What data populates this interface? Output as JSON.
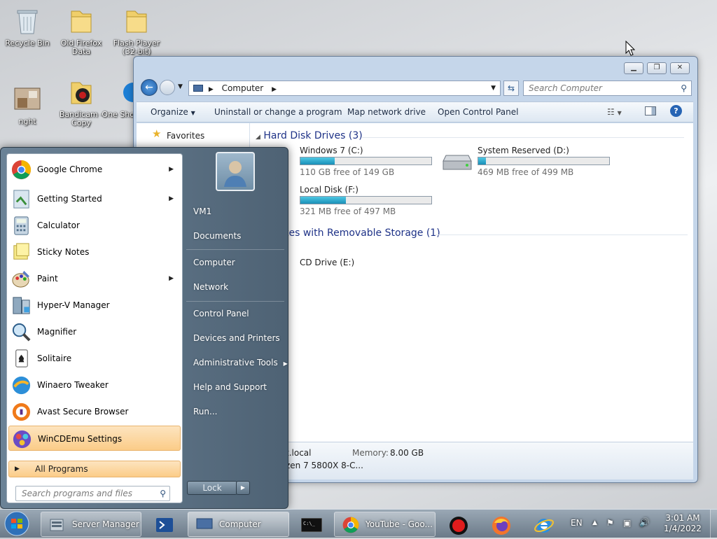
{
  "desktop": {
    "icons": [
      {
        "label": "Recycle Bin"
      },
      {
        "label": "Old Firefox Data"
      },
      {
        "label": "Flash Player (32-bit)"
      },
      {
        "label": "nght"
      },
      {
        "label": "Bandicam - Copy"
      },
      {
        "label": "One Sho"
      }
    ]
  },
  "explorer": {
    "address": {
      "crumb": "Computer"
    },
    "search_placeholder": "Search Computer",
    "commands": [
      "Organize",
      "Uninstall or change a program",
      "Map network drive",
      "Open Control Panel"
    ],
    "nav": {
      "favorites": "Favorites"
    },
    "groups": {
      "hard_disk": "Hard Disk Drives (3)",
      "removable": "tes with Removable Storage (1)"
    },
    "drives": [
      {
        "name": "Windows 7 (C:)",
        "free": "110 GB free of 149 GB",
        "used_fraction": 0.26
      },
      {
        "name": "System Reserved (D:)",
        "free": "469 MB free of 499 MB",
        "used_fraction": 0.06
      },
      {
        "name": "Local Disk (F:)",
        "free": "321 MB free of 497 MB",
        "used_fraction": 0.35
      }
    ],
    "cd": {
      "name": "CD Drive (E:)"
    },
    "details": {
      "domain": "t.local",
      "memory_label": "Memory:",
      "memory_value": "8.00 GB",
      "processor": "zen 7 5800X 8-C..."
    }
  },
  "start_menu": {
    "programs": [
      {
        "label": "Google Chrome",
        "arrow": "▶"
      },
      {
        "label": "Getting Started",
        "arrow": "▶"
      },
      {
        "label": "Calculator",
        "arrow": ""
      },
      {
        "label": "Sticky Notes",
        "arrow": ""
      },
      {
        "label": "Paint",
        "arrow": "▶"
      },
      {
        "label": "Hyper-V Manager",
        "arrow": ""
      },
      {
        "label": "Magnifier",
        "arrow": ""
      },
      {
        "label": "Solitaire",
        "arrow": ""
      },
      {
        "label": "Winaero Tweaker",
        "arrow": ""
      },
      {
        "label": "Avast Secure Browser",
        "arrow": ""
      },
      {
        "label": "WinCDEmu Settings",
        "arrow": ""
      }
    ],
    "all_programs": "All Programs",
    "search_placeholder": "Search programs and files",
    "right": [
      "VM1",
      "Documents",
      "Computer",
      "Network",
      "Control Panel",
      "Devices and Printers",
      "Administrative Tools",
      "Help and Support",
      "Run..."
    ],
    "lock": "Lock"
  },
  "taskbar": {
    "server_manager": "Server Manager",
    "computer": "Computer",
    "youtube": "YouTube - Goo...",
    "lang": "EN",
    "time": "3:01 AM",
    "date": "1/4/2022"
  },
  "colors": {
    "accent": "#1e3287",
    "highlight": "#fbcc88",
    "drive_bar": "#1a8fb8"
  }
}
